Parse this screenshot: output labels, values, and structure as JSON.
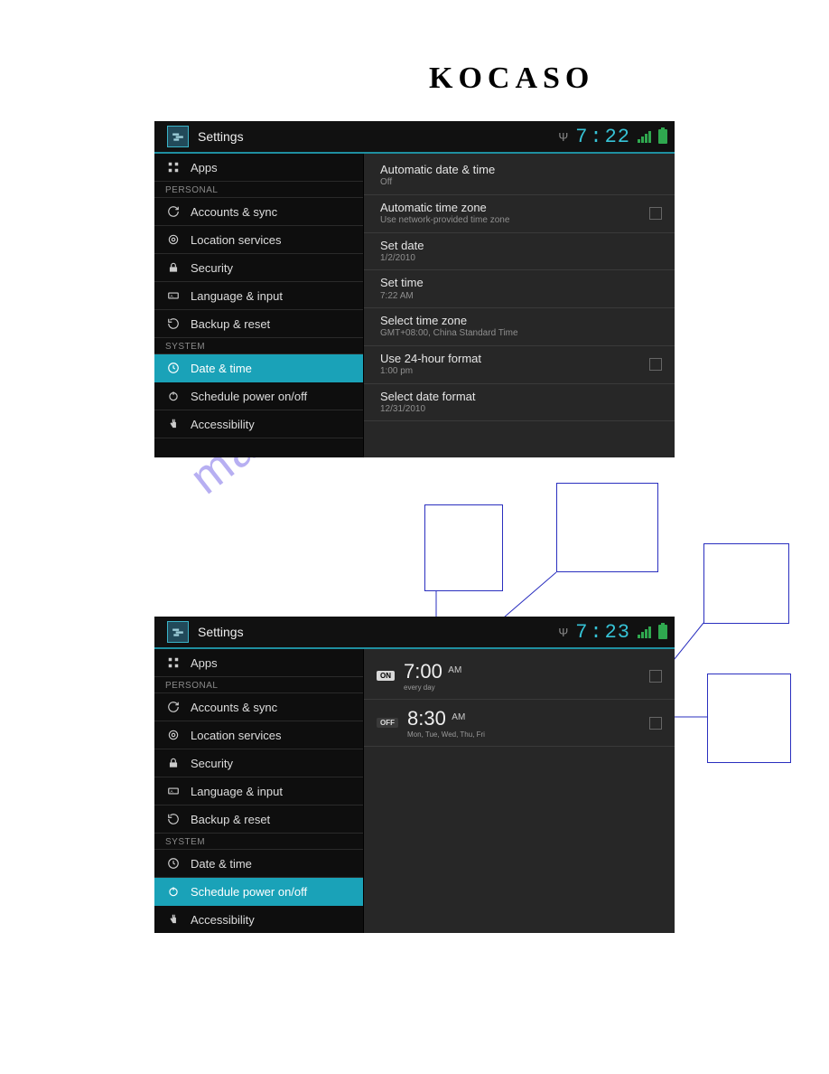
{
  "brand": "KOCASO",
  "watermark": "manualshive.com",
  "screens": {
    "s1": {
      "title": "Settings",
      "clock": {
        "h": "7",
        "m": "22"
      },
      "sidebar": {
        "top_items": [
          {
            "icon": "apps-icon",
            "label": "Apps"
          }
        ],
        "personal_header": "PERSONAL",
        "personal_items": [
          {
            "icon": "sync-icon",
            "label": "Accounts & sync"
          },
          {
            "icon": "location-icon",
            "label": "Location services"
          },
          {
            "icon": "lock-icon",
            "label": "Security"
          },
          {
            "icon": "keyboard-icon",
            "label": "Language & input"
          },
          {
            "icon": "backup-icon",
            "label": "Backup & reset"
          }
        ],
        "system_header": "SYSTEM",
        "system_items": [
          {
            "icon": "clock-icon",
            "label": "Date & time",
            "active": true
          },
          {
            "icon": "power-icon",
            "label": "Schedule power on/off"
          },
          {
            "icon": "access-icon",
            "label": "Accessibility"
          }
        ]
      },
      "rows": [
        {
          "title": "Automatic date & time",
          "sub": "Off"
        },
        {
          "title": "Automatic time zone",
          "sub": "Use network-provided time zone",
          "chk": true
        },
        {
          "title": "Set date",
          "sub": "1/2/2010"
        },
        {
          "title": "Set time",
          "sub": "7:22 AM"
        },
        {
          "title": "Select time zone",
          "sub": "GMT+08:00, China Standard Time"
        },
        {
          "title": "Use 24-hour format",
          "sub": "1:00 pm",
          "chk": true
        },
        {
          "title": "Select date format",
          "sub": "12/31/2010"
        }
      ]
    },
    "s2": {
      "title": "Settings",
      "clock": {
        "h": "7",
        "m": "23"
      },
      "sidebar": {
        "top_items": [
          {
            "icon": "apps-icon",
            "label": "Apps"
          }
        ],
        "personal_header": "PERSONAL",
        "personal_items": [
          {
            "icon": "sync-icon",
            "label": "Accounts & sync"
          },
          {
            "icon": "location-icon",
            "label": "Location services"
          },
          {
            "icon": "lock-icon",
            "label": "Security"
          },
          {
            "icon": "keyboard-icon",
            "label": "Language & input"
          },
          {
            "icon": "backup-icon",
            "label": "Backup & reset"
          }
        ],
        "system_header": "SYSTEM",
        "system_items": [
          {
            "icon": "clock-icon",
            "label": "Date & time"
          },
          {
            "icon": "power-icon",
            "label": "Schedule power on/off",
            "active": true
          },
          {
            "icon": "access-icon",
            "label": "Accessibility"
          }
        ]
      },
      "schedule": {
        "on": {
          "badge": "ON",
          "time": "7:00",
          "ampm": "AM",
          "days": "every day",
          "chk": true
        },
        "off": {
          "badge": "OFF",
          "time": "8:30",
          "ampm": "AM",
          "days": "Mon, Tue, Wed, Thu, Fri",
          "chk": true
        }
      }
    }
  }
}
